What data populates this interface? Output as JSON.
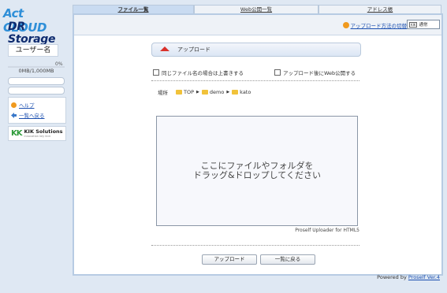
{
  "sidebar": {
    "logo_line1": "Act CLOUD",
    "logo_line2": "DR Storage",
    "user_name": "ユーザー名",
    "quota_percent_label": "0%",
    "quota_percent": 0,
    "quota_text": "0MB/1,000MB",
    "menu": [
      {
        "label": "ヘルプ",
        "icon": "help-icon"
      },
      {
        "label": "一覧へ戻る",
        "icon": "back-icon"
      }
    ],
    "company_mark": "KK",
    "company_name": "KIK Solutions",
    "company_sub": "innovation key kick"
  },
  "tabs": [
    {
      "label": "ファイル一覧",
      "active": true
    },
    {
      "label": "Web公開一覧",
      "active": false
    },
    {
      "label": "アドレス帳",
      "active": false
    }
  ],
  "toolbar": {
    "help_link": "アップロード方法の切替",
    "view_select_value": "通常",
    "view_select_kbd": "KIK"
  },
  "upload": {
    "title": "アップロード",
    "option_overwrite": "同じファイル名の場合は上書きする",
    "option_publish": "アップロード後にWeb公開する",
    "location_label": "場所",
    "breadcrumb": [
      "TOP",
      "demo",
      "kato"
    ],
    "drop_line1": "ここにファイルやフォルダを",
    "drop_line2": "ドラッグ&ドロップしてください",
    "credit": "Proself Uploader for HTML5",
    "upload_button": "アップロード",
    "back_button": "一覧に戻る"
  },
  "footer": {
    "powered_by": "Powered by",
    "product_link": "Proself Ver.4"
  },
  "colors": {
    "accent": "#1b4fb0",
    "page_bg": "#dfe8f3",
    "tab_active": "#c9dbf1",
    "upload_arrow": "#d9302a",
    "folder": "#f1c23a"
  }
}
